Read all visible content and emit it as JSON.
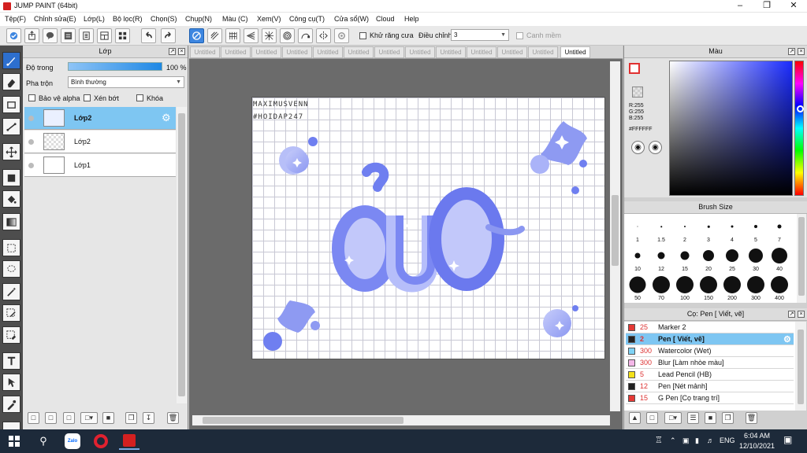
{
  "window": {
    "title": "JUMP PAINT (64bit)"
  },
  "menu": [
    "Tệp(F)",
    "Chỉnh sửa(E)",
    "Lớp(L)",
    "Bộ lọc(R)",
    "Chọn(S)",
    "Chụp(N)",
    "Màu (C)",
    "Xem(V)",
    "Công cụ(T)",
    "Cửa sổ(W)",
    "Cloud",
    "Help"
  ],
  "toolbar": {
    "antialias_label": "Khử răng cưa",
    "adjust_label": "Điều chỉnh",
    "adjust_value": "3",
    "snap_label": "Canh mềm"
  },
  "layers_panel": {
    "title": "Lớp",
    "opacity_label": "Độ trong",
    "opacity_value": "100 %",
    "blend_label": "Pha trộn",
    "blend_value": "Bình thường",
    "protect_alpha": "Bảo vệ alpha",
    "clipping": "Xén bớt",
    "lock": "Khóa",
    "layers": [
      {
        "name": "Lớp2",
        "selected": true
      },
      {
        "name": "Lớp2",
        "selected": false
      },
      {
        "name": "Lớp1",
        "selected": false
      }
    ]
  },
  "tabs": [
    "Untitled",
    "Untitled",
    "Untitled",
    "Untitled",
    "Untitled",
    "Untitled",
    "Untitled",
    "Untitled",
    "Untitled",
    "Untitled",
    "Untitled",
    "Untitled",
    "Untitled"
  ],
  "canvas": {
    "watermark_line1": "MAXIMUSVENN",
    "watermark_line2": "#HOIDAP247"
  },
  "color_panel": {
    "title": "Màu",
    "r": "R:255",
    "g": "G:255",
    "b": "B:255",
    "hex": "#FFFFFF"
  },
  "brush_size_panel": {
    "title": "Brush Size",
    "sizes": [
      "1",
      "1.5",
      "2",
      "3",
      "4",
      "5",
      "7",
      "10",
      "12",
      "15",
      "20",
      "25",
      "30",
      "40",
      "50",
      "70",
      "100",
      "150",
      "200",
      "300",
      "400"
    ]
  },
  "brush_panel": {
    "title": "Cọ: Pen [ Viết, vẽ]",
    "items": [
      {
        "num": "25",
        "name": "Marker 2",
        "color": "#e53935",
        "selected": false
      },
      {
        "num": "2",
        "name": "Pen [ Viết, vẽ]",
        "color": "#222222",
        "selected": true
      },
      {
        "num": "300",
        "name": "Watercolor (Wet)",
        "color": "#7fd3f5",
        "selected": false
      },
      {
        "num": "300",
        "name": "Blur [Làm nhòe màu]",
        "color": "#f4b7e8",
        "selected": false
      },
      {
        "num": "5",
        "name": "Lead Pencil (HB)",
        "color": "#f4e11a",
        "selected": false
      },
      {
        "num": "12",
        "name": "Pen [Nét mảnh]",
        "color": "#222222",
        "selected": false
      },
      {
        "num": "15",
        "name": "G Pen [Cọ trang trí]",
        "color": "#e53935",
        "selected": false
      }
    ]
  },
  "taskbar": {
    "zalo_label": "Zalo",
    "lang": "ENG",
    "time": "6:04 AM",
    "date": "12/10/2021"
  }
}
